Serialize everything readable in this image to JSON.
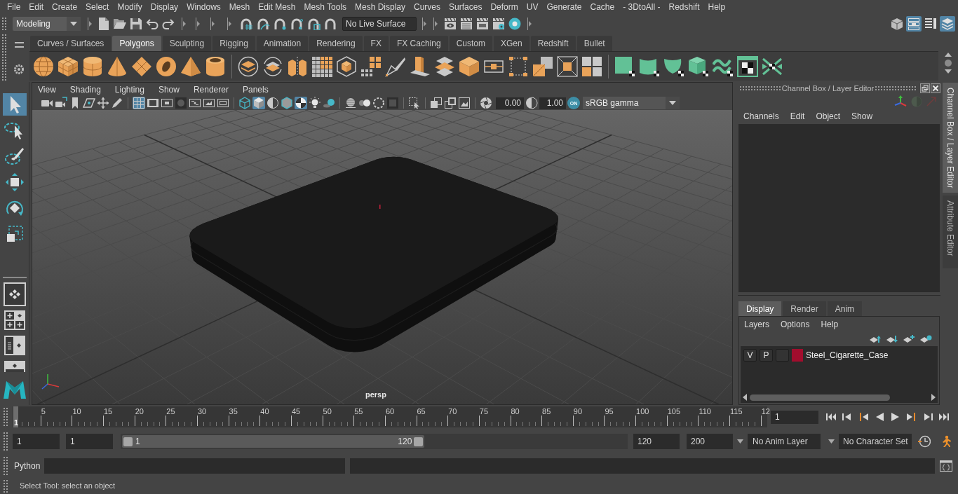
{
  "menu_bar": [
    "File",
    "Edit",
    "Create",
    "Select",
    "Modify",
    "Display",
    "Windows",
    "Mesh",
    "Edit Mesh",
    "Mesh Tools",
    "Mesh Display",
    "Curves",
    "Surfaces",
    "Deform",
    "UV",
    "Generate",
    "Cache",
    "- 3DtoAll -",
    "Redshift",
    "Help"
  ],
  "status_line": {
    "menu_set": "Modeling",
    "live_surface": "No Live Surface"
  },
  "workspace_buttons": [
    {
      "on": false
    },
    {
      "on": true
    },
    {
      "on": false
    },
    {
      "on": true
    }
  ],
  "shelf": {
    "tabs": [
      {
        "label": "Curves / Surfaces",
        "selected": false
      },
      {
        "label": "Polygons",
        "selected": true
      },
      {
        "label": "Sculpting",
        "selected": false
      },
      {
        "label": "Rigging",
        "selected": false
      },
      {
        "label": "Animation",
        "selected": false
      },
      {
        "label": "Rendering",
        "selected": false
      },
      {
        "label": "FX",
        "selected": false
      },
      {
        "label": "FX Caching",
        "selected": false
      },
      {
        "label": "Custom",
        "selected": false
      },
      {
        "label": "XGen",
        "selected": false
      },
      {
        "label": "Redshift",
        "selected": false
      },
      {
        "label": "Bullet",
        "selected": false
      }
    ]
  },
  "toolbox": {
    "tools": [
      {
        "selected": true
      },
      {
        "selected": false
      },
      {
        "selected": false
      },
      {
        "selected": false
      },
      {
        "selected": false
      },
      {
        "selected": false
      }
    ]
  },
  "viewport": {
    "menus": [
      "View",
      "Shading",
      "Lighting",
      "Show",
      "Renderer",
      "Panels"
    ],
    "toolbar_buttons": [
      {
        "on": false
      },
      {
        "on": false
      },
      {
        "on": false
      },
      {
        "on": false
      },
      {
        "on": false
      },
      {
        "on": false
      },
      {
        "on": true
      },
      {
        "on": false
      },
      {
        "on": false
      },
      {
        "on": false
      },
      {
        "on": false
      },
      {
        "on": false
      },
      {
        "on": false
      },
      {
        "on": false
      },
      {
        "on": true
      },
      {
        "on": false
      },
      {
        "on": false
      },
      {
        "on": true
      },
      {
        "on": false
      },
      {
        "on": false
      },
      {
        "on": false
      },
      {
        "on": false
      },
      {
        "on": false
      },
      {
        "on": false
      },
      {
        "on": false
      },
      {
        "on": false
      },
      {
        "on": false
      },
      {
        "on": false
      }
    ],
    "exposure": "0.00",
    "gamma": "1.00",
    "color_management": "ON",
    "color_space": "sRGB gamma",
    "camera": "persp"
  },
  "channel_box": {
    "title": "Channel Box / Layer Editor",
    "menus": [
      "Channels",
      "Edit",
      "Object",
      "Show"
    ]
  },
  "layer_editor": {
    "tabs": [
      {
        "label": "Display",
        "selected": true
      },
      {
        "label": "Render",
        "selected": false
      },
      {
        "label": "Anim",
        "selected": false
      }
    ],
    "menus": [
      "Layers",
      "Options",
      "Help"
    ],
    "layers": [
      {
        "visibility": "V",
        "playback": "P",
        "name": "Steel_Cigarette_Case",
        "color": "#a10d2d"
      }
    ]
  },
  "side_tabs": [
    {
      "label": "Channel Box / Layer Editor",
      "selected": true
    },
    {
      "label": "Attribute Editor",
      "selected": false
    }
  ],
  "time_slider": {
    "level": 0,
    "current_frame_marker": "1",
    "ticks": [
      "5",
      "10",
      "15",
      "20",
      "25",
      "30",
      "35",
      "40",
      "45",
      "50",
      "55",
      "60",
      "65",
      "70",
      "75",
      "80",
      "85",
      "90",
      "95",
      "100",
      "105",
      "110",
      "115",
      "12"
    ],
    "current_frame": "1"
  },
  "range_slider": {
    "animation_start": "1",
    "playback_start": "1",
    "range_start": "1",
    "range_end": "120",
    "level": 0.6,
    "playback_end": "120",
    "animation_end": "200",
    "anim_layer": "No Anim Layer",
    "character_set": "No Character Set"
  },
  "command_line": {
    "language": "Python"
  },
  "help_line": "Select Tool: select an object"
}
